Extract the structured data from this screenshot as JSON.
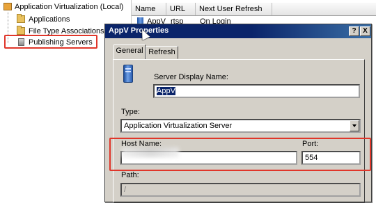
{
  "tree": {
    "root_label": "Application Virtualization (Local)",
    "items": [
      {
        "label": "Applications",
        "icon": "folder-icon"
      },
      {
        "label": "File Type Associations",
        "icon": "folder-icon"
      },
      {
        "label": "Publishing Servers",
        "icon": "server-icon"
      }
    ]
  },
  "list": {
    "columns": [
      "Name",
      "URL",
      "Next User Refresh"
    ],
    "rows": [
      {
        "name": "AppV",
        "url": "rtsp",
        "refresh": "On Login"
      }
    ]
  },
  "dialog": {
    "title": "AppV Properties",
    "help_button": "?",
    "close_button": "X",
    "tabs": [
      {
        "label": "General",
        "active": true
      },
      {
        "label": "Refresh",
        "active": false
      }
    ],
    "server_display_name_label": "Server Display Name:",
    "server_display_name_value": "AppV",
    "type_label": "Type:",
    "type_value": "Application Virtualization Server",
    "host_name_label": "Host Name:",
    "host_name_value": "",
    "port_label": "Port:",
    "port_value": "554",
    "path_label": "Path:",
    "path_value": "/"
  },
  "colors": {
    "highlight_border": "#e0362a",
    "titlebar": "#0a246a",
    "dialog_face": "#d4d0c8"
  }
}
